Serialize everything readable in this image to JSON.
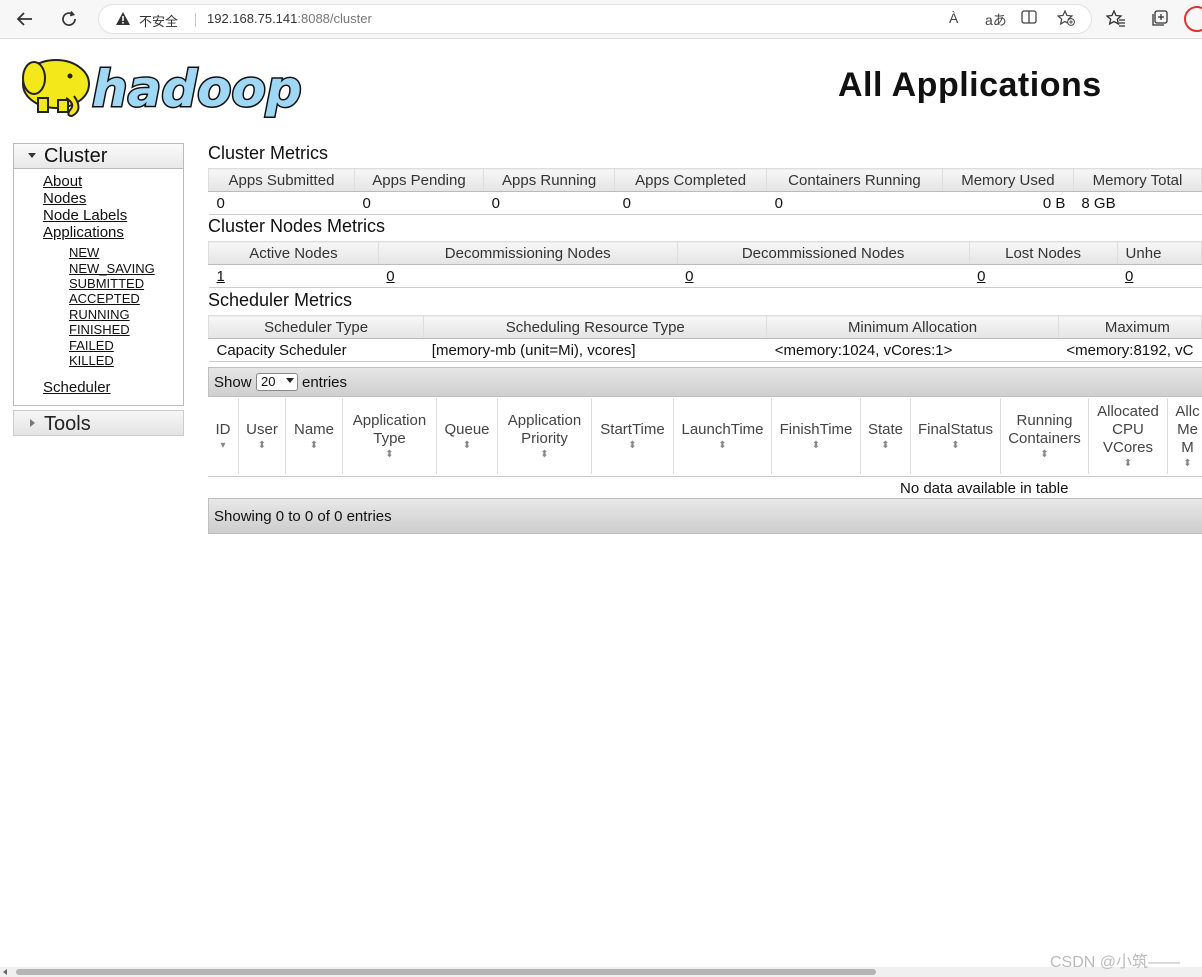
{
  "browser": {
    "insecure_label": "不安全",
    "url_host": "192.168.75.141",
    "url_rest": ":8088/cluster",
    "read_aloud": "À",
    "translate": "aあ"
  },
  "header": {
    "title": "All Applications",
    "logo_text": "hadoop"
  },
  "sidebar": {
    "cluster_label": "Cluster",
    "links": [
      "About",
      "Nodes",
      "Node Labels",
      "Applications"
    ],
    "app_states": [
      "NEW",
      "NEW_SAVING",
      "SUBMITTED",
      "ACCEPTED",
      "RUNNING",
      "FINISHED",
      "FAILED",
      "KILLED"
    ],
    "scheduler": "Scheduler",
    "tools_label": "Tools"
  },
  "cluster_metrics": {
    "title": "Cluster Metrics",
    "headers": [
      "Apps Submitted",
      "Apps Pending",
      "Apps Running",
      "Apps Completed",
      "Containers Running",
      "Memory Used",
      "Memory Total"
    ],
    "values": [
      "0",
      "0",
      "0",
      "0",
      "0",
      "0 B",
      "8 GB"
    ]
  },
  "node_metrics": {
    "title": "Cluster Nodes Metrics",
    "headers": [
      "Active Nodes",
      "Decommissioning Nodes",
      "Decommissioned Nodes",
      "Lost Nodes",
      "Unhe"
    ],
    "values": [
      "1",
      "0",
      "0",
      "0",
      "0"
    ]
  },
  "scheduler_metrics": {
    "title": "Scheduler Metrics",
    "headers": [
      "Scheduler Type",
      "Scheduling Resource Type",
      "Minimum Allocation",
      "Maximum"
    ],
    "values": [
      "Capacity Scheduler",
      "[memory-mb (unit=Mi), vcores]",
      "<memory:1024, vCores:1>",
      "<memory:8192, vC"
    ]
  },
  "apps_table": {
    "show_label": "Show",
    "page_size": "20",
    "entries_label": "entries",
    "columns": [
      [
        "ID"
      ],
      [
        "User"
      ],
      [
        "Name"
      ],
      [
        "Application",
        "Type"
      ],
      [
        "Queue"
      ],
      [
        "Application",
        "Priority"
      ],
      [
        "StartTime"
      ],
      [
        "LaunchTime"
      ],
      [
        "FinishTime"
      ],
      [
        "State"
      ],
      [
        "FinalStatus"
      ],
      [
        "Running",
        "Containers"
      ],
      [
        "Allocated",
        "CPU",
        "VCores"
      ],
      [
        "Allc",
        "Me",
        "M"
      ]
    ],
    "empty_message": "No data available in table",
    "footer": "Showing 0 to 0 of 0 entries"
  },
  "watermark": "CSDN @小筑——"
}
